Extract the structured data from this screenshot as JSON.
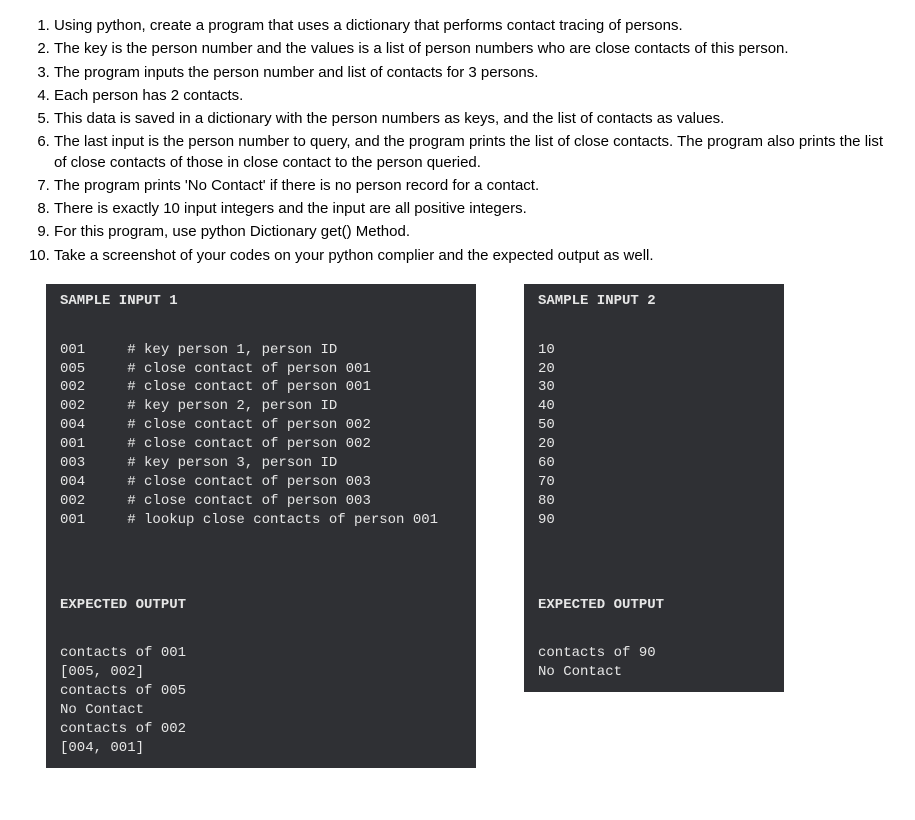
{
  "instructions": [
    "Using python, create a program that uses a dictionary that performs contact tracing of persons.",
    "The key is the person number and the values is a list of person numbers who are close contacts of this person.",
    "The program inputs the person number and list of contacts for 3 persons.",
    "Each person has 2 contacts.",
    "This data is saved in a dictionary with the person numbers as keys, and the list of contacts as values.",
    "The last input is the person number to query, and the program prints the list of close contacts. The program also prints the list of close contacts of those in close contact to the person queried.",
    "The program prints 'No Contact' if there is no person record for a contact.",
    "There is exactly 10 input integers and the input are all positive integers.",
    "For this program, use python Dictionary get() Method.",
    "Take a screenshot of your codes on your python complier and the expected output as well."
  ],
  "sample1": {
    "header": "SAMPLE INPUT 1",
    "body": "001     # key person 1, person ID\n005     # close contact of person 001\n002     # close contact of person 001\n002     # key person 2, person ID\n004     # close contact of person 002\n001     # close contact of person 002\n003     # key person 3, person ID\n004     # close contact of person 003\n002     # close contact of person 003\n001     # lookup close contacts of person 001",
    "out_header": "EXPECTED OUTPUT",
    "out_body": "contacts of 001\n[005, 002]\ncontacts of 005\nNo Contact\ncontacts of 002\n[004, 001]"
  },
  "sample2": {
    "header": "SAMPLE INPUT 2",
    "body": "10\n20\n30\n40\n50\n20\n60\n70\n80\n90",
    "out_header": "EXPECTED OUTPUT",
    "out_body": "contacts of 90\nNo Contact"
  }
}
